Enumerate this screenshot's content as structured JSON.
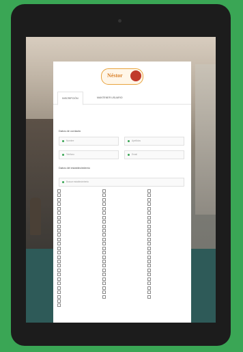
{
  "brand": {
    "logo_text": "Néstor"
  },
  "tabs": [
    {
      "label": "INSCRIPCIÓN",
      "active": true
    },
    {
      "label": "MANTENER USUARIO",
      "active": false
    }
  ],
  "section1": {
    "title": "Datos de contacto",
    "fields": [
      {
        "placeholder": "Nombre"
      },
      {
        "placeholder": "Apellidos"
      },
      {
        "placeholder": "Teléfono"
      },
      {
        "placeholder": "Email"
      }
    ]
  },
  "section2": {
    "title": "Datos del establecimiento",
    "search_placeholder": "Buscar establecimiento"
  },
  "colors": {
    "accent": "#3aa655",
    "logo": "#d9822b",
    "teal": "#2e5a58"
  }
}
